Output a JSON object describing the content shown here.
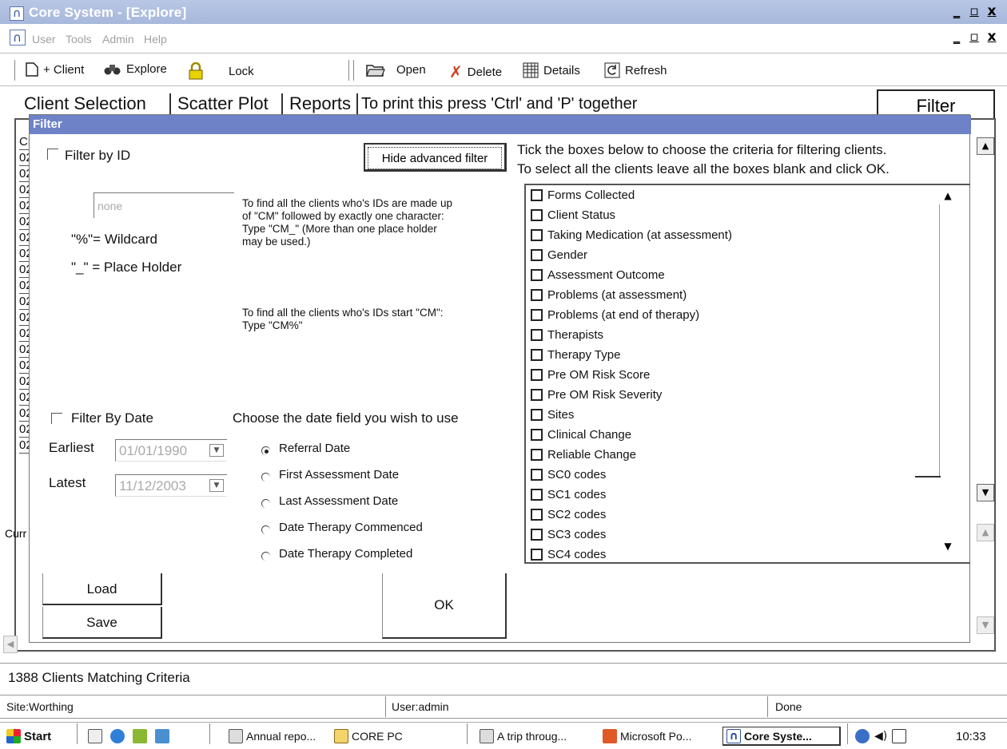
{
  "window": {
    "title": "Core System - [Explore]",
    "controls": [
      "_",
      "Ɖ",
      "x"
    ]
  },
  "menu": [
    "User",
    "Tools",
    "Admin",
    "Help"
  ],
  "toolbar": {
    "client": "+ Client",
    "explore": "Explore",
    "lock": "Lock",
    "open": "Open",
    "delete": "Delete",
    "details": "Details",
    "refresh": "Refresh"
  },
  "tabs": {
    "client_selection": "Client Selection",
    "scatter_plot": "Scatter Plot",
    "reports": "Reports",
    "print_note": "To print this press 'Ctrl' and 'P' together",
    "filter": "Filter"
  },
  "background_list": {
    "header": "Cl",
    "rows": [
      "02",
      "02",
      "02",
      "02",
      "02",
      "02",
      "02",
      "02",
      "02",
      "02",
      "02",
      "02",
      "02",
      "02",
      "02",
      "02",
      "02",
      "02",
      "02"
    ],
    "current_label": "Curr"
  },
  "dialog": {
    "title": "Filter",
    "filter_by_id": "Filter by ID",
    "hide_advanced": "Hide advanced filter",
    "instructions_1": "Tick the boxes below to choose the criteria for filtering clients.",
    "instructions_2": "To select all the clients leave all the boxes blank and click OK.",
    "id_placeholder": "none",
    "wildcard": "\"%\"= Wildcard",
    "placeholder_help": "\"_\" = Place Holder",
    "note_1": "To find all the clients who's IDs are made up of \"CM\" followed by exactly one character: Type \"CM_\" (More than one place holder may be used.)",
    "note_2": "To find all the clients who's IDs start \"CM\": Type \"CM%\"",
    "filter_by_date": "Filter By Date",
    "date_field_prompt": "Choose the date field you wish to use",
    "earliest_label": "Earliest",
    "earliest_value": "01/01/1990",
    "latest_label": "Latest",
    "latest_value": "11/12/2003",
    "date_fields": [
      "Referral Date",
      "First Assessment Date",
      "Last Assessment Date",
      "Date Therapy Commenced",
      "Date Therapy Completed"
    ],
    "selected_date_field": "Referral Date",
    "criteria": [
      "Forms Collected",
      "Client Status",
      "Taking Medication (at assessment)",
      "Gender",
      "Assessment Outcome",
      "Problems (at assessment)",
      "Problems (at end of therapy)",
      "Therapists",
      "Therapy Type",
      "Pre OM Risk Score",
      "Pre OM Risk Severity",
      "Sites",
      "Clinical Change",
      "Reliable Change",
      "SC0 codes",
      "SC1 codes",
      "SC2 codes",
      "SC3 codes",
      "SC4 codes"
    ],
    "load": "Load",
    "save": "Save",
    "ok": "OK"
  },
  "status": {
    "matching": "1388 Clients Matching Criteria",
    "site": "Site:Worthing",
    "user": "User:admin",
    "state": "Done"
  },
  "taskbar": {
    "start": "Start",
    "tasks": [
      "Annual repo...",
      "CORE PC",
      "A trip throug...",
      "Microsoft Po...",
      "Core Syste..."
    ],
    "clock": "10:33"
  }
}
